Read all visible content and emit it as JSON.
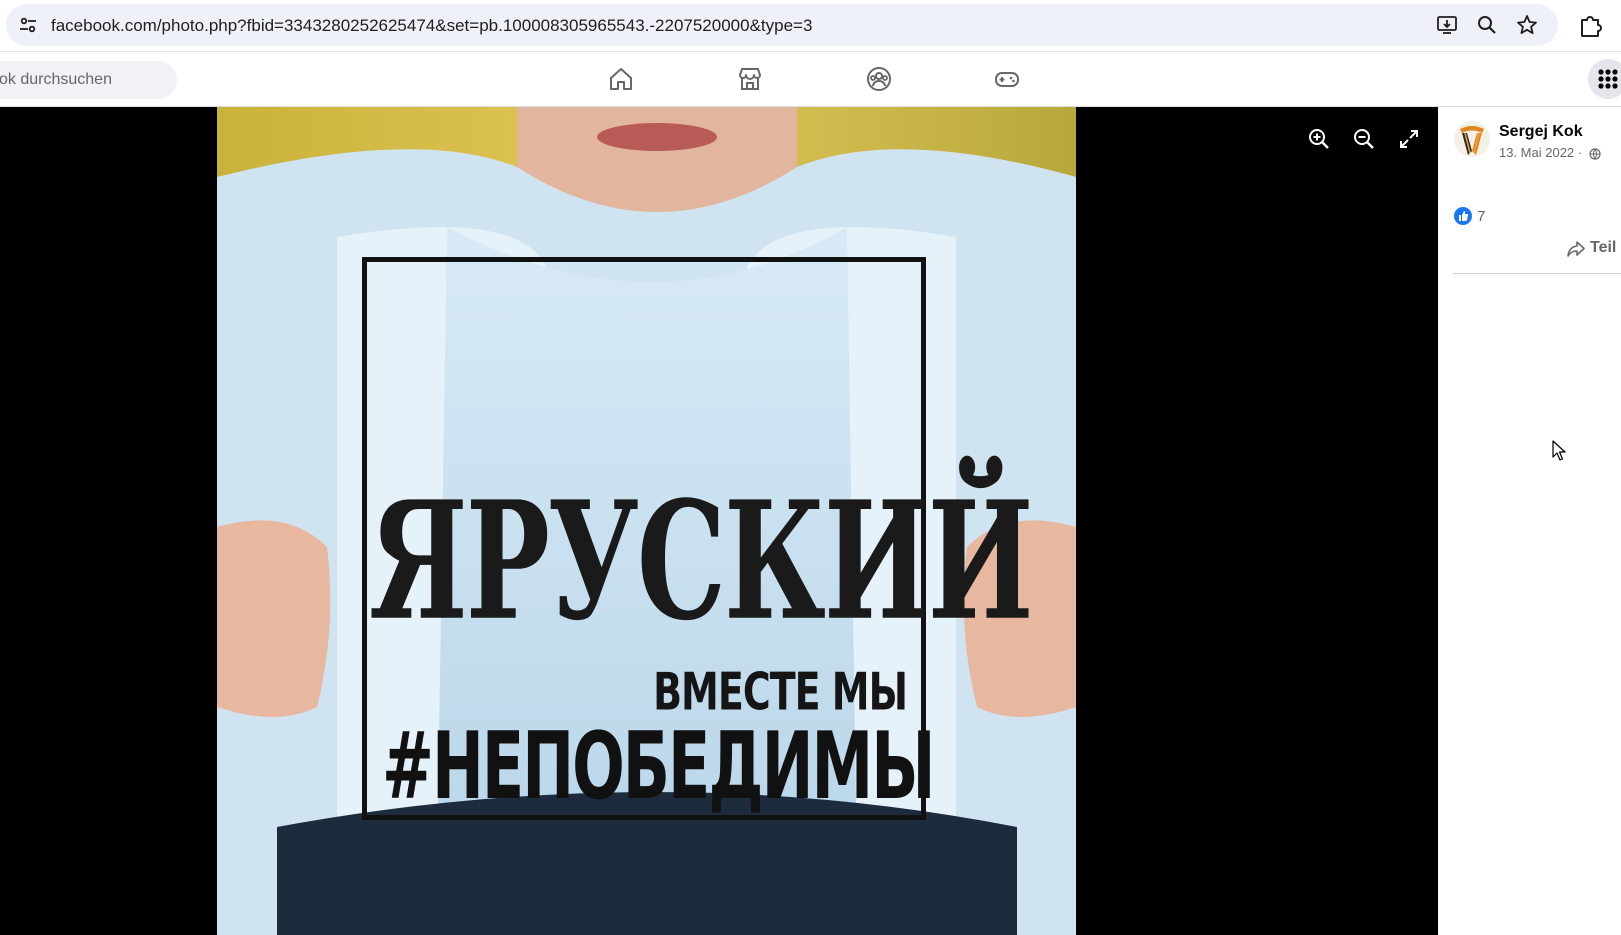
{
  "browser": {
    "url": "facebook.com/photo.php?fbid=3343280252625474&set=pb.100008305965543.-2207520000&type=3"
  },
  "fb": {
    "search_placeholder": "ok durchsuchen"
  },
  "photo": {
    "line1": "ЯРУСКИЙ",
    "line2": "ВМЕСТЕ МЫ",
    "line3": "#НЕПОБЕДИМЫ"
  },
  "post": {
    "author": "Sergej Kok",
    "date": "13. Mai 2022 ·",
    "likes": "7",
    "share_label": "Teil"
  },
  "colors": {
    "accent": "#1877f2",
    "viewer_bg": "#000000",
    "address_bar": "#eef1f8"
  },
  "icons": [
    "tune-icon",
    "install-icon",
    "zoom-icon",
    "star-icon",
    "extensions-icon",
    "home-icon",
    "marketplace-icon",
    "groups-icon",
    "gaming-icon",
    "apps-grid-icon",
    "zoom-in-icon",
    "zoom-out-icon",
    "fullscreen-icon",
    "globe-icon",
    "like-icon",
    "share-icon"
  ]
}
